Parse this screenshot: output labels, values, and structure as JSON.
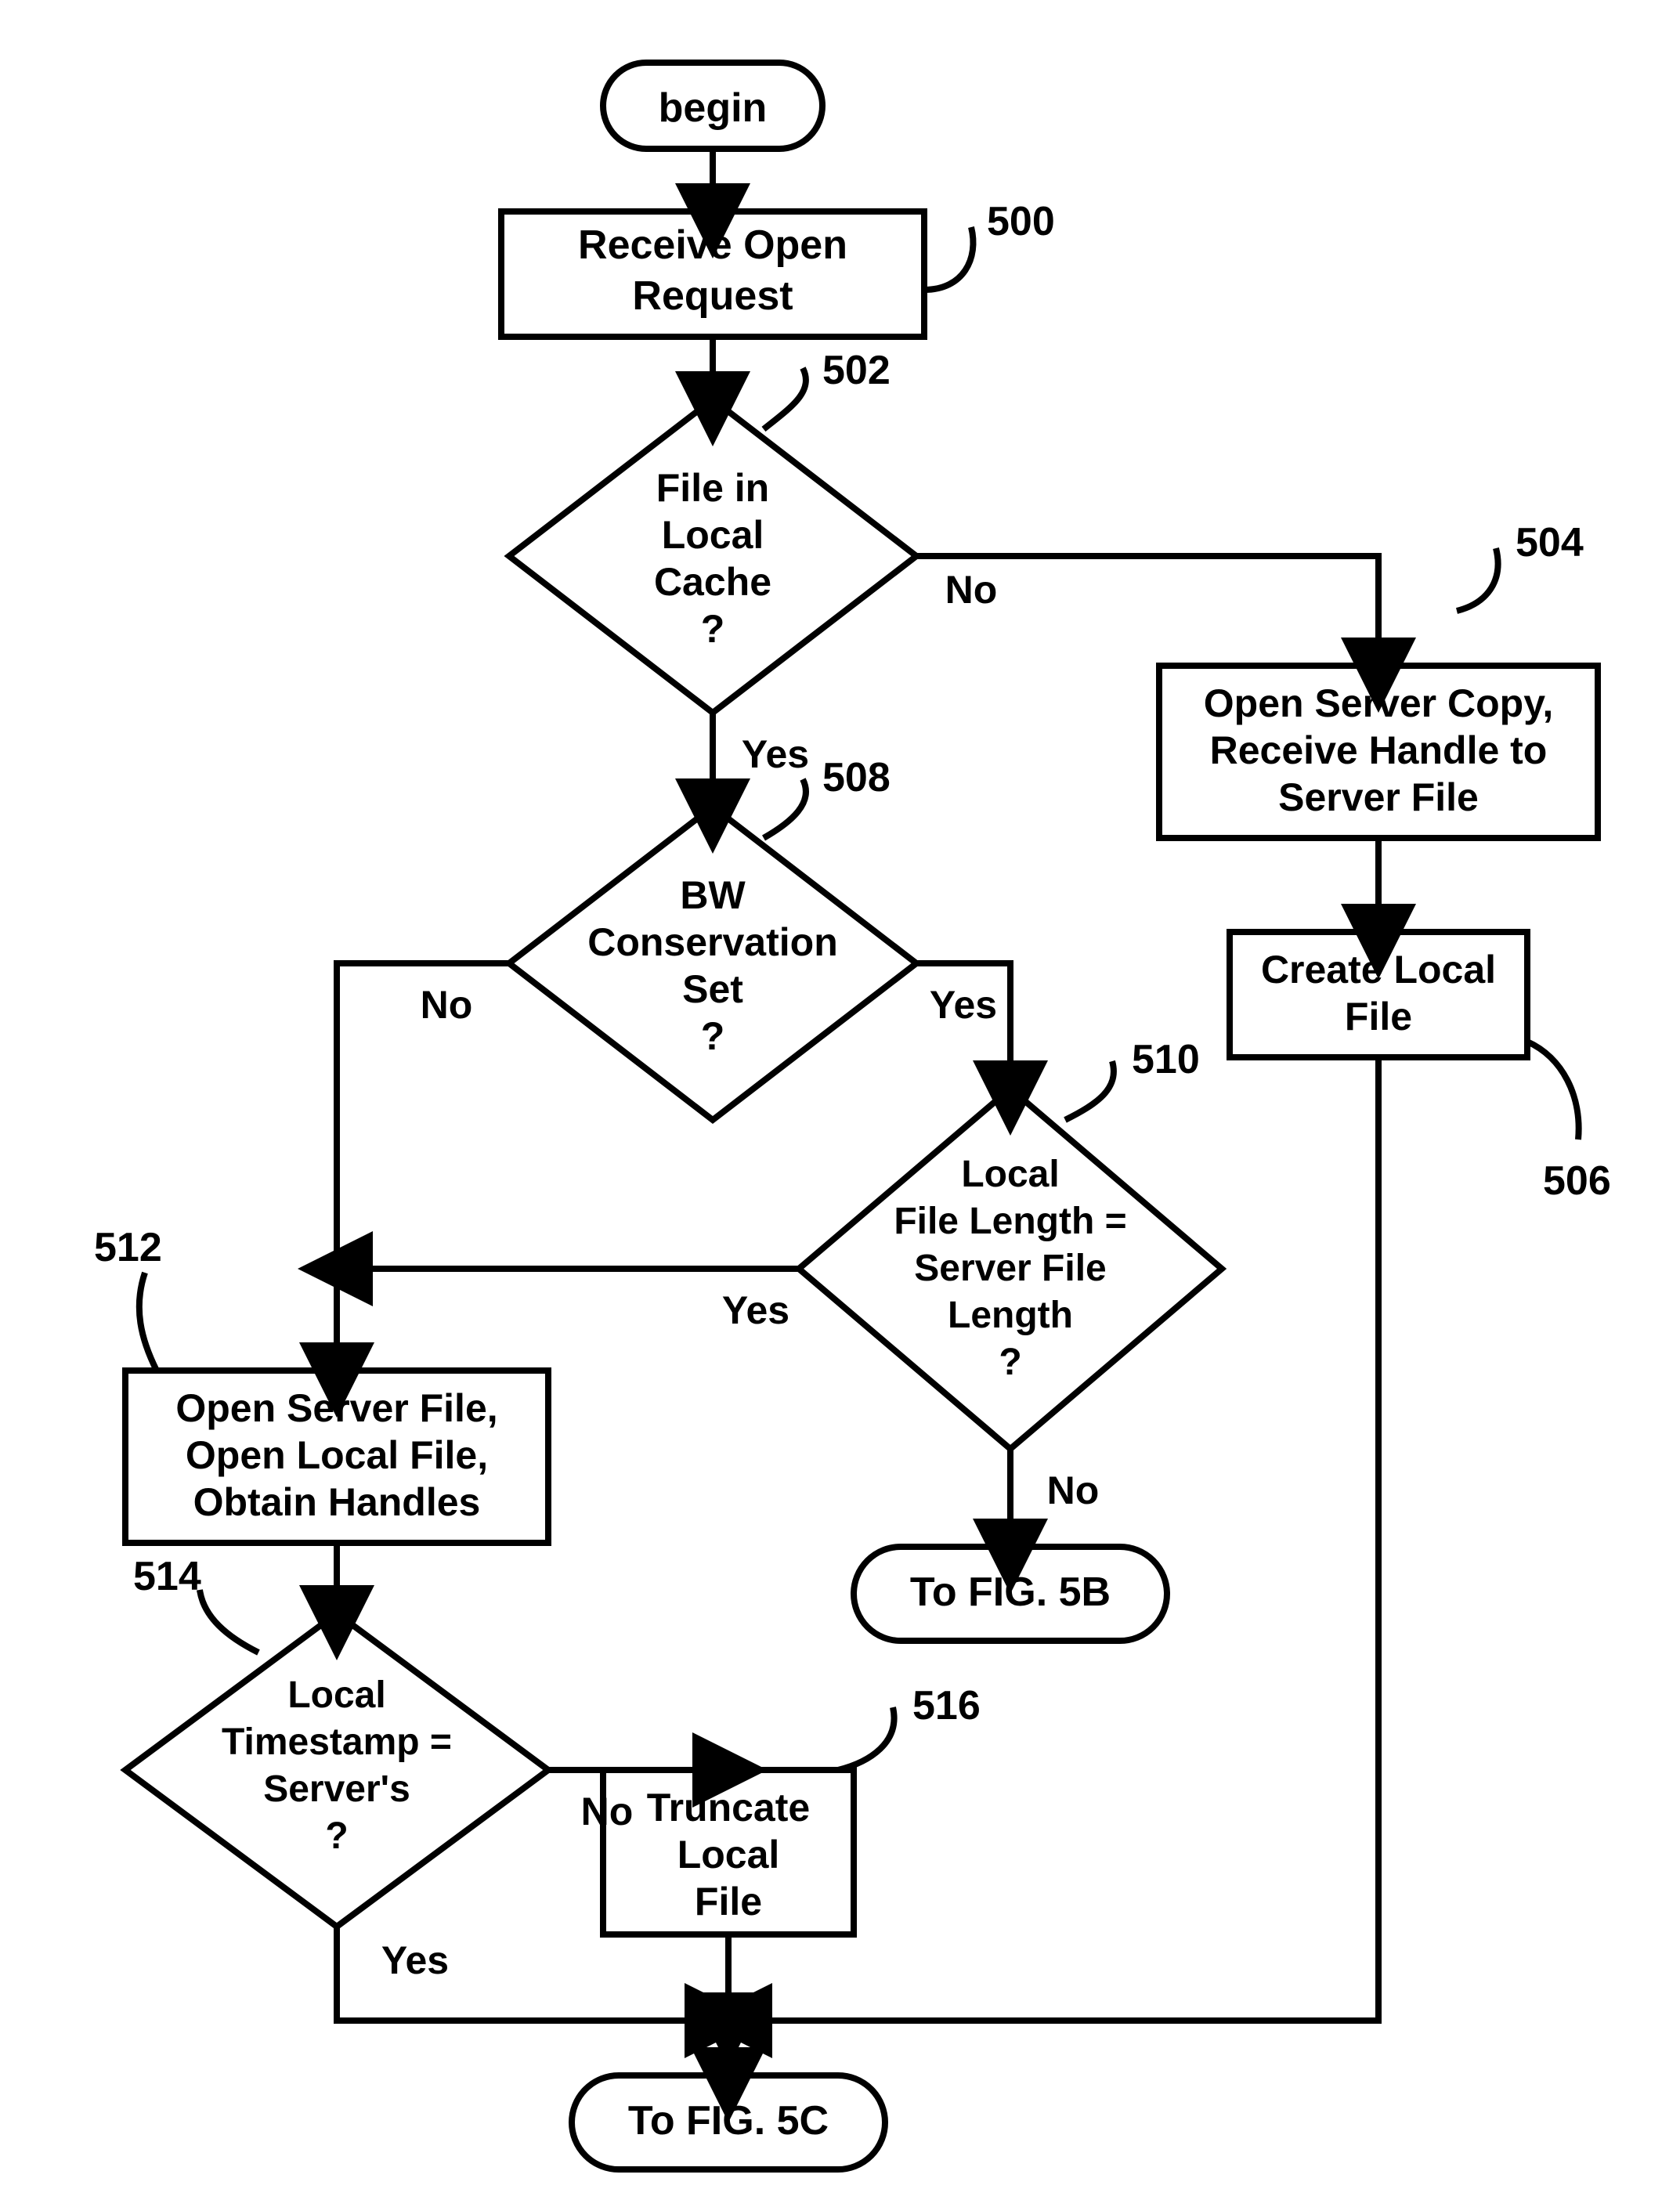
{
  "nodes": {
    "begin": {
      "lines": [
        "begin"
      ]
    },
    "n500": {
      "lines": [
        "Receive Open",
        "Request"
      ]
    },
    "n502": {
      "lines": [
        "File in",
        "Local",
        "Cache",
        "?"
      ]
    },
    "n504": {
      "lines": [
        "Open Server Copy,",
        "Receive Handle to",
        "Server File"
      ]
    },
    "n506": {
      "lines": [
        "Create Local",
        "File"
      ]
    },
    "n508": {
      "lines": [
        "BW",
        "Conservation",
        "Set",
        "?"
      ]
    },
    "n510": {
      "lines": [
        "Local",
        "File Length =",
        "Server File",
        "Length",
        "?"
      ]
    },
    "n512": {
      "lines": [
        "Open Server File,",
        "Open Local File,",
        "Obtain Handles"
      ]
    },
    "n514": {
      "lines": [
        "Local",
        "Timestamp =",
        "Server's",
        "?"
      ]
    },
    "n516": {
      "lines": [
        "Truncate",
        "Local",
        "File"
      ]
    },
    "to5b": {
      "lines": [
        "To FIG. 5B"
      ]
    },
    "to5c": {
      "lines": [
        "To FIG. 5C"
      ]
    }
  },
  "refs": {
    "r500": "500",
    "r502": "502",
    "r504": "504",
    "r506": "506",
    "r508": "508",
    "r510": "510",
    "r512": "512",
    "r514": "514",
    "r516": "516"
  },
  "labels": {
    "yes": "Yes",
    "no": "No"
  }
}
